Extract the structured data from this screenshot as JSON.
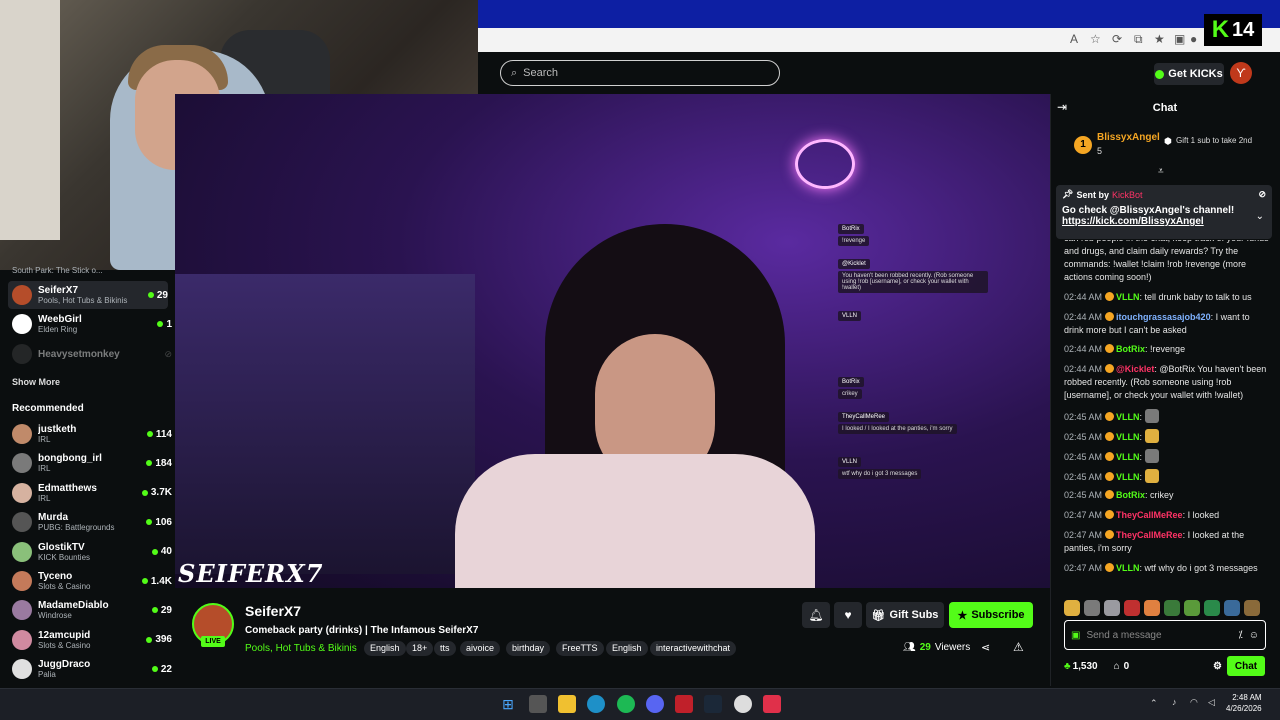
{
  "overlay_badge": {
    "letter": "K",
    "number": "14"
  },
  "browser": {
    "address_icons": [
      "read-aloud-icon",
      "favorite-icon",
      "extensions-icon",
      "split-icon",
      "favorites-bar-icon",
      "collections-icon",
      "profile-icon"
    ]
  },
  "topnav": {
    "search_placeholder": "Search",
    "get_kicks": "Get KICKs"
  },
  "sidebar": {
    "following_partial": {
      "name": "South Park: The Stick o..."
    },
    "following": [
      {
        "name": "SeiferX7",
        "category": "Pools, Hot Tubs & Bikinis",
        "viewers": "29",
        "color": "#b54d2a"
      },
      {
        "name": "WeebGirl",
        "category": "Elden Ring",
        "viewers": "1",
        "color": "#ffffff"
      },
      {
        "name": "Heavysetmonkey",
        "category": "",
        "viewers": "",
        "color": "#444444"
      }
    ],
    "show_more": "Show More",
    "recommended_title": "Recommended",
    "recommended": [
      {
        "name": "justketh",
        "category": "IRL",
        "viewers": "114",
        "color": "#c08a6a"
      },
      {
        "name": "bongbong_irl",
        "category": "IRL",
        "viewers": "184",
        "color": "#7a7a7a"
      },
      {
        "name": "Edmatthews",
        "category": "IRL",
        "viewers": "3.7K",
        "color": "#d6b2a0"
      },
      {
        "name": "Murda",
        "category": "PUBG: Battlegrounds",
        "viewers": "106",
        "color": "#555555"
      },
      {
        "name": "GlostikTV",
        "category": "KICK Bounties",
        "viewers": "40",
        "color": "#8ac07a"
      },
      {
        "name": "Tyceno",
        "category": "Slots & Casino",
        "viewers": "1.4K",
        "color": "#c47a5a"
      },
      {
        "name": "MadameDiablo",
        "category": "Windrose",
        "viewers": "29",
        "color": "#9a7aa0"
      },
      {
        "name": "12amcupid",
        "category": "Slots & Casino",
        "viewers": "396",
        "color": "#d08aa0"
      },
      {
        "name": "JuggDraco",
        "category": "Palia",
        "viewers": "22",
        "color": "#e0e0e0"
      }
    ]
  },
  "video": {
    "watermark": "SEIFERX7",
    "overlay_chat": [
      {
        "user": "BotRix",
        "text": "!revenge"
      },
      {
        "user": "@Kicklet",
        "text": "You haven't been robbed recently. (Rob someone using !rob [username], or check your wallet with !wallet)"
      },
      {
        "user": "VLLN",
        "text": ""
      },
      {
        "user": "BotRix",
        "text": "crikey"
      },
      {
        "user": "TheyCallMeRee",
        "text": "I looked / I looked at the panties, i'm sorry"
      },
      {
        "user": "VLLN",
        "text": "wtf why do i got 3 messages"
      }
    ]
  },
  "stream": {
    "channel": "SeiferX7",
    "live": "LIVE",
    "title": "Comeback party (drinks) | The Infamous SeiferX7",
    "category": "Pools, Hot Tubs & Bikinis",
    "tags": [
      "English",
      "18+",
      "tts",
      "aivoice",
      "birthday",
      "FreeTTS",
      "English",
      "interactivewithchat"
    ],
    "gift_subs": "Gift Subs",
    "subscribe": "Subscribe",
    "viewers_count": "29",
    "viewers_label": "Viewers"
  },
  "chat": {
    "title": "Chat",
    "top_gifter": {
      "rank": "1",
      "name": "BlissyxAngel",
      "count": "5",
      "hint": "Gift 1 sub to take 2nd"
    },
    "pinned": {
      "sent_by_label": "Sent by",
      "sender": "KickBot",
      "text": "Go check @BlissyxAngel's channel!",
      "link": "https://kick.com/BlissyxAngel"
    },
    "messages": [
      {
        "time": "",
        "user": "",
        "text": "can rob people in the chat, keep track of your funds and drugs, and claim daily rewards? Try the commands: !wallet !claim !rob !revenge (more actions coming soon!)",
        "ucls": "u-green"
      },
      {
        "time": "02:44 AM",
        "user": "VLLN",
        "text": "tell drunk baby to talk to us",
        "ucls": "u-green"
      },
      {
        "time": "02:44 AM",
        "user": "itouchgrassasajob420",
        "text": "I want to drink more but I can't be asked",
        "ucls": "u-blue"
      },
      {
        "time": "02:44 AM",
        "user": "BotRix",
        "text": "!revenge",
        "ucls": "u-green"
      },
      {
        "time": "02:44 AM",
        "user": "@Kicklet",
        "text": "@BotRix You haven't been robbed recently. (Rob someone using !rob [username], or check your wallet with !wallet)",
        "ucls": "u-red"
      },
      {
        "time": "02:45 AM",
        "user": "VLLN",
        "text": "",
        "ucls": "u-green",
        "emote": "#7a7a7a"
      },
      {
        "time": "02:45 AM",
        "user": "VLLN",
        "text": "",
        "ucls": "u-green",
        "emote": "#e0b040"
      },
      {
        "time": "02:45 AM",
        "user": "VLLN",
        "text": "",
        "ucls": "u-green",
        "emote": "#7a7a7a"
      },
      {
        "time": "02:45 AM",
        "user": "VLLN",
        "text": "",
        "ucls": "u-green",
        "emote": "#e0b040"
      },
      {
        "time": "02:45 AM",
        "user": "BotRix",
        "text": "crikey",
        "ucls": "u-green"
      },
      {
        "time": "02:47 AM",
        "user": "TheyCallMeRee",
        "text": "I looked",
        "ucls": "u-red"
      },
      {
        "time": "02:47 AM",
        "user": "TheyCallMeRee",
        "text": "I looked at the panties, i'm sorry",
        "ucls": "u-red"
      },
      {
        "time": "02:47 AM",
        "user": "VLLN",
        "text": "wtf why do i got 3 messages",
        "ucls": "u-green"
      }
    ],
    "input_placeholder": "Send a message",
    "kicks": "1,530",
    "gifts": "0",
    "send": "Chat"
  },
  "taskbar": {
    "time": "2:48 AM",
    "date": "4/26/2026"
  }
}
